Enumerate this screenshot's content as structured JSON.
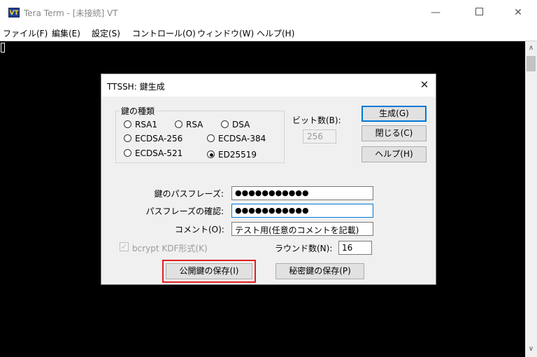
{
  "window": {
    "icon_text": "VT",
    "title": "Tera Term - [未接続] VT",
    "minimize_glyph": "—",
    "close_glyph": "✕"
  },
  "menu": {
    "items": [
      {
        "label": "ファイル(F)"
      },
      {
        "label": "編集(E)"
      },
      {
        "label": "設定(S)"
      },
      {
        "label": "コントロール(O)"
      },
      {
        "label": "ウィンドウ(W)"
      },
      {
        "label": "ヘルプ(H)"
      }
    ]
  },
  "dialog": {
    "title": "TTSSH: 鍵生成",
    "close_glyph": "✕",
    "key_type": {
      "legend": "鍵の種類",
      "options": [
        "RSA1",
        "RSA",
        "DSA",
        "ECDSA-256",
        "ECDSA-384",
        "ECDSA-521",
        "ED25519"
      ],
      "selected": "ED25519"
    },
    "bits": {
      "label": "ビット数(B):",
      "value": "256"
    },
    "buttons": {
      "generate": "生成(G)",
      "close": "閉じる(C)",
      "help": "ヘルプ(H)",
      "save_public": "公開鍵の保存(I)",
      "save_private": "秘密鍵の保存(P)"
    },
    "passphrase": {
      "label": "鍵のパスフレーズ:",
      "value": "●●●●●●●●●●●"
    },
    "confirm": {
      "label": "パスフレーズの確認:",
      "value": "●●●●●●●●●●●"
    },
    "comment": {
      "label": "コメント(O):",
      "value": "テスト用(任意のコメントを記載)"
    },
    "bcrypt": {
      "label": "bcrypt KDF形式(K)",
      "checked": true,
      "check_glyph": "✓"
    },
    "rounds": {
      "label": "ラウンド数(N):",
      "value": "16"
    }
  },
  "colors": {
    "highlight": "#e02020",
    "focus": "#0078d7",
    "terminal_bg": "#000000"
  }
}
